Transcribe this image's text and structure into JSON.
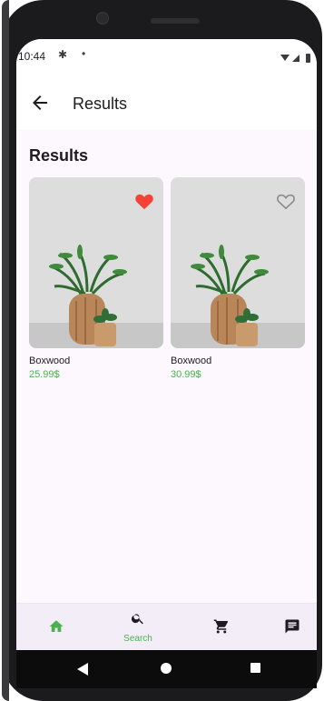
{
  "status_bar": {
    "time": "10:44",
    "icons": [
      "settings-icon",
      "notification-dot",
      "wifi-icon",
      "signal-icon",
      "battery-icon"
    ]
  },
  "app_bar": {
    "title": "Results",
    "back_icon": "back-arrow-icon"
  },
  "section": {
    "title": "Results"
  },
  "products": [
    {
      "name": "Boxwood",
      "price": "25.99$",
      "favorite": true
    },
    {
      "name": "Boxwood",
      "price": "30.99$",
      "favorite": false
    }
  ],
  "bottom_nav": {
    "items": [
      {
        "icon": "home-icon",
        "label": "",
        "active": true
      },
      {
        "icon": "search-icon",
        "label": "Search",
        "active": false
      },
      {
        "icon": "cart-icon",
        "label": "",
        "active": false
      },
      {
        "icon": "chat-icon",
        "label": "",
        "active": false
      }
    ]
  },
  "colors": {
    "accent": "#4caf50",
    "favorite": "#f44336",
    "background": "#fdf7fe",
    "nav_background": "#f3edf7"
  }
}
